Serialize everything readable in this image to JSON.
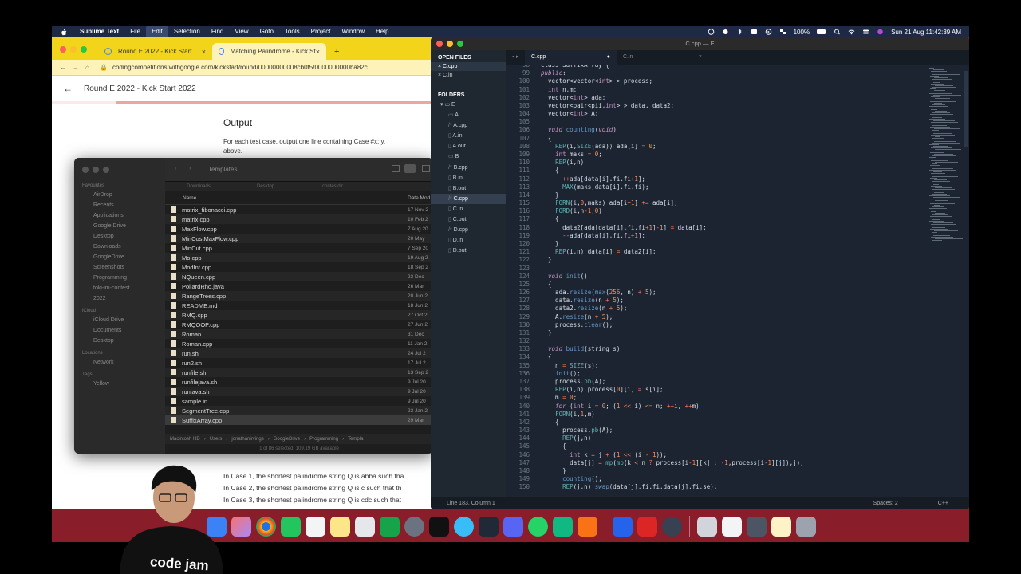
{
  "menubar": {
    "app": "Sublime Text",
    "menus": [
      "File",
      "Edit",
      "Selection",
      "Find",
      "View",
      "Goto",
      "Tools",
      "Project",
      "Window",
      "Help"
    ],
    "battery": "100%",
    "datetime": "Sun 21 Aug  11:42:39 AM"
  },
  "browser": {
    "tabs": [
      {
        "title": "Round E 2022 - Kick Start",
        "close": "×"
      },
      {
        "title": "Matching Palindrome - Kick St",
        "close": "×"
      }
    ],
    "new_tab": "+",
    "url": "codingcompetitions.withgoogle.com/kickstart/round/00000000008cb0f5/0000000000ba82c",
    "page_title": "Round E 2022 - Kick Start 2022",
    "section_heading": "Output",
    "output_text": "For each test case, output one line containing Case #x: y,",
    "output_text_cont": "above.",
    "cases": [
      "In Case 1, the shortest palindrome string Q is abba such tha",
      "In Case 2, the shortest palindrome string Q is c such that th",
      "In Case 3, the shortest palindrome string Q is cdc such that"
    ]
  },
  "finder": {
    "title": "Templates",
    "sidebar": {
      "favourites_label": "Favourites",
      "favourites": [
        "AirDrop",
        "Recents",
        "Applications",
        "Google Drive",
        "Desktop",
        "Downloads",
        "GoogleDrive",
        "Screenshots",
        "Programming",
        "toki-im-contest",
        "2022"
      ],
      "icloud_label": "iCloud",
      "icloud": [
        "iCloud Drive",
        "Documents",
        "Desktop"
      ],
      "locations_label": "Locations",
      "locations": [
        "Network"
      ],
      "tags_label": "Tags",
      "tags": [
        "Yellow"
      ]
    },
    "path_tabs": [
      "Downloads",
      "Desktop",
      "contestdir",
      ""
    ],
    "col_name": "Name",
    "col_date": "Date Mod",
    "files": [
      {
        "name": "matrix_fibonacci.cpp",
        "date": "17 Nov 2"
      },
      {
        "name": "matrix.cpp",
        "date": "10 Feb 2"
      },
      {
        "name": "MaxFlow.cpp",
        "date": "7 Aug 20"
      },
      {
        "name": "MinCostMaxFlow.cpp",
        "date": "20 May"
      },
      {
        "name": "MinCut.cpp",
        "date": "7 Sep 20"
      },
      {
        "name": "Mo.cpp",
        "date": "19 Aug 2"
      },
      {
        "name": "ModInt.cpp",
        "date": "18 Sep 2"
      },
      {
        "name": "NQueen.cpp",
        "date": "23 Dec"
      },
      {
        "name": "PollardRho.java",
        "date": "26 Mar"
      },
      {
        "name": "RangeTrees.cpp",
        "date": "20 Jun 2"
      },
      {
        "name": "README.md",
        "date": "18 Jun 2"
      },
      {
        "name": "RMQ.cpp",
        "date": "27 Oct 2"
      },
      {
        "name": "RMQOOP.cpp",
        "date": "27 Jun 2"
      },
      {
        "name": "Roman",
        "date": "31 Dec"
      },
      {
        "name": "Roman.cpp",
        "date": "11 Jan 2"
      },
      {
        "name": "run.sh",
        "date": "24 Jul 2"
      },
      {
        "name": "run2.sh",
        "date": "17 Jul 2"
      },
      {
        "name": "runfile.sh",
        "date": "13 Sep 2"
      },
      {
        "name": "runfilejava.sh",
        "date": "9 Jul 20"
      },
      {
        "name": "runjava.sh",
        "date": "9 Jul 20"
      },
      {
        "name": "sample.in",
        "date": "9 Jul 20"
      },
      {
        "name": "SegmentTree.cpp",
        "date": "23 Jan 2"
      },
      {
        "name": "SuffixArray.cpp",
        "date": "29 Mar"
      }
    ],
    "pathbar": [
      "Macintosh HD",
      "Users",
      "jonathanirvings",
      "GoogleDrive",
      "Programming",
      "Templa"
    ],
    "status": "1 of 86 selected, 109.19 GB available"
  },
  "sublime": {
    "title": "C.cpp — E",
    "open_files_label": "OPEN FILES",
    "open_files": [
      "C.cpp",
      "C.in"
    ],
    "folders_label": "FOLDERS",
    "folder_root": "E",
    "folder_items": [
      "A",
      "A.cpp",
      "A.in",
      "A.out",
      "B",
      "B.cpp",
      "B.in",
      "B.out",
      "C.cpp",
      "C.in",
      "C.out",
      "D.cpp",
      "D.in",
      "D.out"
    ],
    "tabs": [
      {
        "name": "C.cpp"
      },
      {
        "name": "C.in"
      }
    ],
    "status_left": "Line 183, Column 1",
    "status_spaces": "Spaces: 2",
    "status_syntax": "C++",
    "first_line_no": 98,
    "code": [
      [
        [
          "",
          "class SuffixArray {"
        ]
      ],
      [
        [
          "kw",
          "public"
        ],
        [
          "",
          ":"
        ]
      ],
      [
        [
          "",
          "  vector<vector<"
        ],
        [
          "ty",
          "int"
        ],
        [
          "",
          "> > process;"
        ]
      ],
      [
        [
          "",
          "  "
        ],
        [
          "ty",
          "int"
        ],
        [
          "",
          " n,m;"
        ]
      ],
      [
        [
          "",
          "  vector<"
        ],
        [
          "ty",
          "int"
        ],
        [
          "",
          "> ada;"
        ]
      ],
      [
        [
          "",
          "  vector<pair<pii,"
        ],
        [
          "ty",
          "int"
        ],
        [
          "",
          "> > data, data2;"
        ]
      ],
      [
        [
          "",
          "  vector<"
        ],
        [
          "ty",
          "int"
        ],
        [
          "",
          "> A;"
        ]
      ],
      [
        [
          "",
          ""
        ]
      ],
      [
        [
          "",
          "  "
        ],
        [
          "kw",
          "void"
        ],
        [
          "",
          " "
        ],
        [
          "fn",
          "counting"
        ],
        [
          "",
          "("
        ],
        [
          "kw",
          "void"
        ],
        [
          "",
          ")"
        ]
      ],
      [
        [
          "",
          "  {"
        ]
      ],
      [
        [
          "",
          "    "
        ],
        [
          "mc",
          "REP"
        ],
        [
          "",
          "(i,"
        ],
        [
          "mc",
          "SIZE"
        ],
        [
          "",
          "(ada)) ada[i] "
        ],
        [
          "op",
          "="
        ],
        [
          "",
          " "
        ],
        [
          "nu",
          "0"
        ],
        [
          "",
          ";"
        ]
      ],
      [
        [
          "",
          "    "
        ],
        [
          "ty",
          "int"
        ],
        [
          "",
          " maks "
        ],
        [
          "op",
          "="
        ],
        [
          "",
          " "
        ],
        [
          "nu",
          "0"
        ],
        [
          "",
          ";"
        ]
      ],
      [
        [
          "",
          "    "
        ],
        [
          "mc",
          "REP"
        ],
        [
          "",
          "(i,n)"
        ]
      ],
      [
        [
          "",
          "    {"
        ]
      ],
      [
        [
          "",
          "      "
        ],
        [
          "op",
          "++"
        ],
        [
          "",
          "ada[data[i].fi.fi"
        ],
        [
          "op",
          "+"
        ],
        [
          "nu",
          "1"
        ],
        [
          "",
          "];"
        ]
      ],
      [
        [
          "",
          "      "
        ],
        [
          "mc",
          "MAX"
        ],
        [
          "",
          "(maks,data[i].fi.fi);"
        ]
      ],
      [
        [
          "",
          "    }"
        ]
      ],
      [
        [
          "",
          "    "
        ],
        [
          "mc",
          "FORN"
        ],
        [
          "",
          "(i,"
        ],
        [
          "nu",
          "0"
        ],
        [
          "",
          ",maks) ada[i"
        ],
        [
          "op",
          "+"
        ],
        [
          "nu",
          "1"
        ],
        [
          "",
          "] "
        ],
        [
          "op",
          "+="
        ],
        [
          "",
          " ada[i];"
        ]
      ],
      [
        [
          "",
          "    "
        ],
        [
          "mc",
          "FORD"
        ],
        [
          "",
          "(i,n"
        ],
        [
          "op",
          "-"
        ],
        [
          "nu",
          "1"
        ],
        [
          "",
          ","
        ],
        [
          "nu",
          "0"
        ],
        [
          "",
          ")"
        ]
      ],
      [
        [
          "",
          "    {"
        ]
      ],
      [
        [
          "",
          "      data2[ada[data[i].fi.fi"
        ],
        [
          "op",
          "+"
        ],
        [
          "nu",
          "1"
        ],
        [
          "",
          "]"
        ],
        [
          "op",
          "-"
        ],
        [
          "nu",
          "1"
        ],
        [
          "",
          "] "
        ],
        [
          "op",
          "="
        ],
        [
          "",
          " data[i];"
        ]
      ],
      [
        [
          "",
          "      "
        ],
        [
          "op",
          "--"
        ],
        [
          "",
          "ada[data[i].fi.fi"
        ],
        [
          "op",
          "+"
        ],
        [
          "nu",
          "1"
        ],
        [
          "",
          "];"
        ]
      ],
      [
        [
          "",
          "    }"
        ]
      ],
      [
        [
          "",
          "    "
        ],
        [
          "mc",
          "REP"
        ],
        [
          "",
          "(i,n) data[i] "
        ],
        [
          "op",
          "="
        ],
        [
          "",
          " data2[i];"
        ]
      ],
      [
        [
          "",
          "  }"
        ]
      ],
      [
        [
          "",
          ""
        ]
      ],
      [
        [
          "",
          "  "
        ],
        [
          "kw",
          "void"
        ],
        [
          "",
          " "
        ],
        [
          "fn",
          "init"
        ],
        [
          "",
          "()"
        ]
      ],
      [
        [
          "",
          "  {"
        ]
      ],
      [
        [
          "",
          "    ada."
        ],
        [
          "fn",
          "resize"
        ],
        [
          "",
          "("
        ],
        [
          "fn",
          "max"
        ],
        [
          "",
          "("
        ],
        [
          "nu",
          "256"
        ],
        [
          "",
          ", n) "
        ],
        [
          "op",
          "+"
        ],
        [
          "",
          " "
        ],
        [
          "nu",
          "5"
        ],
        [
          "",
          ");"
        ]
      ],
      [
        [
          "",
          "    data."
        ],
        [
          "fn",
          "resize"
        ],
        [
          "",
          "(n "
        ],
        [
          "op",
          "+"
        ],
        [
          "",
          " "
        ],
        [
          "nu",
          "5"
        ],
        [
          "",
          ");"
        ]
      ],
      [
        [
          "",
          "    data2."
        ],
        [
          "fn",
          "resize"
        ],
        [
          "",
          "(n "
        ],
        [
          "op",
          "+"
        ],
        [
          "",
          " "
        ],
        [
          "nu",
          "5"
        ],
        [
          "",
          ");"
        ]
      ],
      [
        [
          "",
          "    A."
        ],
        [
          "fn",
          "resize"
        ],
        [
          "",
          "(n "
        ],
        [
          "op",
          "+"
        ],
        [
          "",
          " "
        ],
        [
          "nu",
          "5"
        ],
        [
          "",
          ");"
        ]
      ],
      [
        [
          "",
          "    process."
        ],
        [
          "fn",
          "clear"
        ],
        [
          "",
          "();"
        ]
      ],
      [
        [
          "",
          "  }"
        ]
      ],
      [
        [
          "",
          ""
        ]
      ],
      [
        [
          "",
          "  "
        ],
        [
          "kw",
          "void"
        ],
        [
          "",
          " "
        ],
        [
          "fn",
          "build"
        ],
        [
          "",
          "(string s)"
        ]
      ],
      [
        [
          "",
          "  {"
        ]
      ],
      [
        [
          "",
          "    n "
        ],
        [
          "op",
          "="
        ],
        [
          "",
          " "
        ],
        [
          "mc",
          "SIZE"
        ],
        [
          "",
          "(s);"
        ]
      ],
      [
        [
          "",
          "    "
        ],
        [
          "fn",
          "init"
        ],
        [
          "",
          "();"
        ]
      ],
      [
        [
          "",
          "    process."
        ],
        [
          "mc",
          "pb"
        ],
        [
          "",
          "(A);"
        ]
      ],
      [
        [
          "",
          "    "
        ],
        [
          "mc",
          "REP"
        ],
        [
          "",
          "(i,n) process["
        ],
        [
          "nu",
          "0"
        ],
        [
          "",
          "][i] "
        ],
        [
          "op",
          "="
        ],
        [
          "",
          " s[i];"
        ]
      ],
      [
        [
          "",
          "    m "
        ],
        [
          "op",
          "="
        ],
        [
          "",
          " "
        ],
        [
          "nu",
          "0"
        ],
        [
          "",
          ";"
        ]
      ],
      [
        [
          "",
          "    "
        ],
        [
          "kw",
          "for"
        ],
        [
          "",
          " ("
        ],
        [
          "ty",
          "int"
        ],
        [
          "",
          " i "
        ],
        [
          "op",
          "="
        ],
        [
          "",
          " "
        ],
        [
          "nu",
          "0"
        ],
        [
          "",
          "; ("
        ],
        [
          "nu",
          "1"
        ],
        [
          "",
          " "
        ],
        [
          "op",
          "<<"
        ],
        [
          "",
          " i) "
        ],
        [
          "op",
          "<="
        ],
        [
          "",
          " n; "
        ],
        [
          "op",
          "++"
        ],
        [
          "",
          "i, "
        ],
        [
          "op",
          "++"
        ],
        [
          "",
          "m)"
        ]
      ],
      [
        [
          "",
          "    "
        ],
        [
          "mc",
          "FORN"
        ],
        [
          "",
          "(i,"
        ],
        [
          "nu",
          "1"
        ],
        [
          "",
          ",m)"
        ]
      ],
      [
        [
          "",
          "    {"
        ]
      ],
      [
        [
          "",
          "      process."
        ],
        [
          "mc",
          "pb"
        ],
        [
          "",
          "(A);"
        ]
      ],
      [
        [
          "",
          "      "
        ],
        [
          "mc",
          "REP"
        ],
        [
          "",
          "(j,n)"
        ]
      ],
      [
        [
          "",
          "      {"
        ]
      ],
      [
        [
          "",
          "        "
        ],
        [
          "ty",
          "int"
        ],
        [
          "",
          " k "
        ],
        [
          "op",
          "="
        ],
        [
          "",
          " j "
        ],
        [
          "op",
          "+"
        ],
        [
          "",
          " ("
        ],
        [
          "nu",
          "1"
        ],
        [
          "",
          " "
        ],
        [
          "op",
          "<<"
        ],
        [
          "",
          " (i "
        ],
        [
          "op",
          "-"
        ],
        [
          "",
          " "
        ],
        [
          "nu",
          "1"
        ],
        [
          "",
          "));"
        ]
      ],
      [
        [
          "",
          "        data[j] "
        ],
        [
          "op",
          "="
        ],
        [
          "",
          " "
        ],
        [
          "mc",
          "mp"
        ],
        [
          "",
          "("
        ],
        [
          "mc",
          "mp"
        ],
        [
          "",
          "(k "
        ],
        [
          "op",
          "<"
        ],
        [
          "",
          " n "
        ],
        [
          "op",
          "?"
        ],
        [
          "",
          " process[i"
        ],
        [
          "op",
          "-"
        ],
        [
          "nu",
          "1"
        ],
        [
          "",
          "][k] "
        ],
        [
          "op",
          ":"
        ],
        [
          "",
          " "
        ],
        [
          "op",
          "-"
        ],
        [
          "nu",
          "1"
        ],
        [
          "",
          ",process[i"
        ],
        [
          "op",
          "-"
        ],
        [
          "nu",
          "1"
        ],
        [
          "",
          "][j]),j);"
        ]
      ],
      [
        [
          "",
          "      }"
        ]
      ],
      [
        [
          "",
          "      "
        ],
        [
          "fn",
          "counting"
        ],
        [
          "",
          "();"
        ]
      ],
      [
        [
          "",
          "      "
        ],
        [
          "mc",
          "REP"
        ],
        [
          "",
          "(j,n) "
        ],
        [
          "fn",
          "swap"
        ],
        [
          "",
          "(data[j].fi.fi,data[j].fi.se);"
        ]
      ]
    ]
  },
  "webcam": {
    "shirt_text": "code jam"
  },
  "colors": {
    "menubar": "#1e2a44",
    "chrome_tab": "#f2d51a",
    "sublime_bg": "#1b2430",
    "wallpaper": "#8a1d2a"
  }
}
